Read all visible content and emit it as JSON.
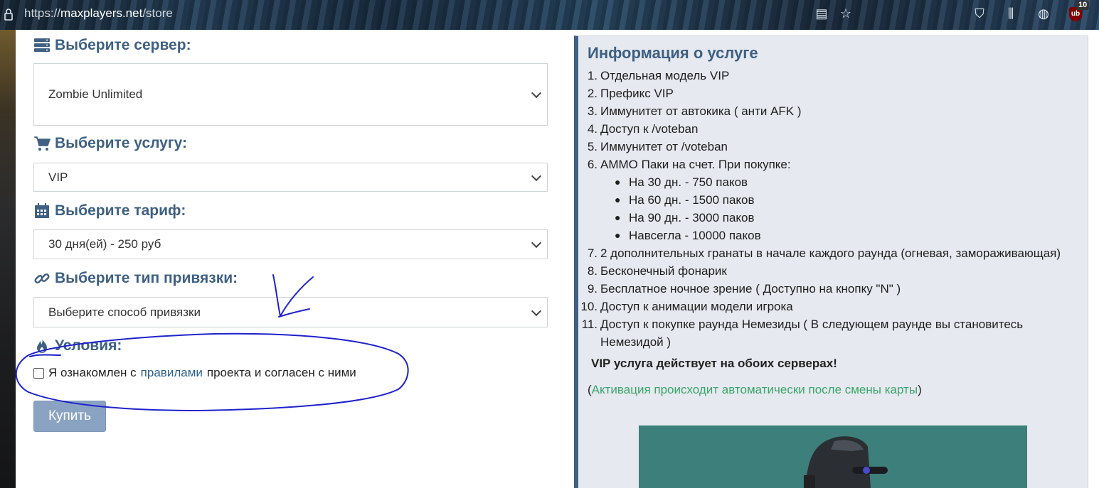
{
  "browser": {
    "url_prefix": "https://",
    "url_host": "maxplayers.net",
    "url_path": "/store",
    "badge_count": "10"
  },
  "form": {
    "server_label": "Выберите сервер:",
    "server_value": "Zombie Unlimited",
    "service_label": "Выберите услугу:",
    "service_value": "VIP",
    "tariff_label": "Выберите тариф:",
    "tariff_value": "30 дня(ей) - 250 руб",
    "binding_label": "Выберите тип привязки:",
    "binding_value": "Выберите способ привязки",
    "conditions_label": "Условия:",
    "agree_pre": "Я ознакомлен с",
    "agree_link": "правилами",
    "agree_post": "проекта и согласен с ними",
    "buy_label": "Купить"
  },
  "info": {
    "title": "Информация о услуге",
    "items": [
      {
        "num": "1.",
        "text": "Отдельная модель VIP"
      },
      {
        "num": "2.",
        "text": "Префикс VIP"
      },
      {
        "num": "3.",
        "text": "Иммунитет от автокика ( анти AFK )"
      },
      {
        "num": "4.",
        "text": "Доступ к /voteban"
      },
      {
        "num": "5.",
        "text": "Иммунитет от /voteban"
      },
      {
        "num": "6.",
        "text": "AMMO Паки на счет. При покупке:"
      },
      {
        "num": "7.",
        "text": "2 дополнительных гранаты в начале каждого раунда (огневая, замораживающая)"
      },
      {
        "num": "8.",
        "text": "Бесконечный фонарик"
      },
      {
        "num": "9.",
        "text": "Бесплатное ночное зрение ( Доступно на кнопку \"N\" )"
      },
      {
        "num": "10.",
        "text": "Доступ к анимации модели игрока"
      },
      {
        "num": "11.",
        "text": "Доступ к покупке раунда Немезиды ( В следующем раунде вы становитесь"
      }
    ],
    "item11_cont": "Немезидой )",
    "ammo": [
      "На 30 дн. - 750 паков",
      "На 60 дн. - 1500 паков",
      "На 90 дн. - 3000 паков",
      "Навсегла - 10000 паков"
    ],
    "vip_note": "VIP услуга действует на обоих серверах!",
    "activation_open": "(",
    "activation_text": "Активация происходит автоматически после смены карты",
    "activation_close": ")"
  }
}
